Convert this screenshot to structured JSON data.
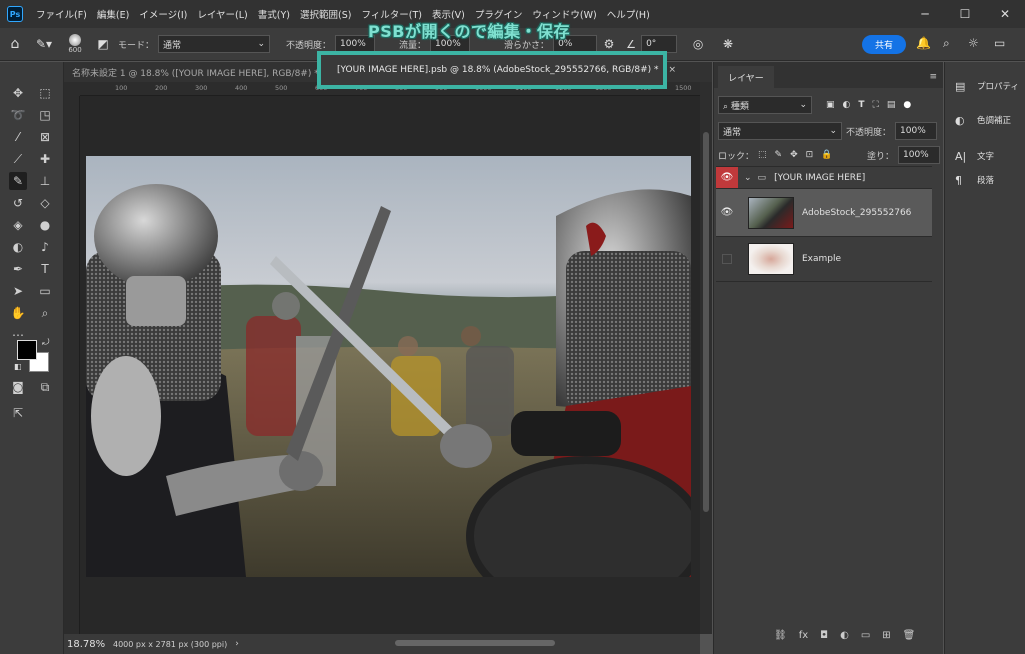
{
  "app": {
    "logo": "Ps",
    "menu": [
      "ファイル(F)",
      "編集(E)",
      "イメージ(I)",
      "レイヤー(L)",
      "書式(Y)",
      "選択範囲(S)",
      "フィルター(T)",
      "表示(V)",
      "プラグイン",
      "ウィンドウ(W)",
      "ヘルプ(H)"
    ]
  },
  "options": {
    "brush_size": "600",
    "mode_label": "モード：",
    "mode_value": "通常",
    "opacity_label": "不透明度：",
    "opacity_value": "100%",
    "flow_label": "流量：",
    "flow_value": "100%",
    "smoothing_label": "滑らかさ：",
    "smoothing_value": "0%",
    "angle_value": "0°",
    "share_label": "共有"
  },
  "tabs": [
    {
      "label": "名称未設定 1 @ 18.8% ([YOUR IMAGE HERE], RGB/8#) *",
      "active": false
    },
    {
      "label": "[YOUR IMAGE HERE].psb @ 18.8% (AdobeStock_295552766, RGB/8#) *",
      "active": true
    }
  ],
  "annotation": {
    "title": "PSBが開くので編集・保存"
  },
  "status": {
    "zoom": "18.78%",
    "doc_info": "4000 px x 2781 px (300 ppi)"
  },
  "ruler_ticks": [
    "100",
    "200",
    "300",
    "400",
    "500",
    "600",
    "700",
    "800",
    "900",
    "1000",
    "1100",
    "1200",
    "1300",
    "1400",
    "1500"
  ],
  "layers_panel": {
    "tab": "レイヤー",
    "filter_kind": "種類",
    "blend_mode": "通常",
    "opacity_label": "不透明度：",
    "opacity_value": "100%",
    "lock_label": "ロック：",
    "fill_label": "塗り：",
    "fill_value": "100%",
    "layers": [
      {
        "name": "[YOUR IMAGE HERE]",
        "type": "group",
        "visible": true
      },
      {
        "name": "AdobeStock_295552766",
        "type": "image",
        "visible": true,
        "selected": true
      },
      {
        "name": "Example",
        "type": "image",
        "visible": false
      }
    ]
  },
  "right_dock": {
    "items": [
      "プロパティ",
      "色調補正",
      "文字",
      "段落"
    ]
  },
  "colors": {
    "accent_blue": "#1473e6",
    "annotation_teal": "#3cb4a4",
    "eye_red": "#c0393b",
    "foreground": "#000000",
    "background": "#ffffff"
  }
}
